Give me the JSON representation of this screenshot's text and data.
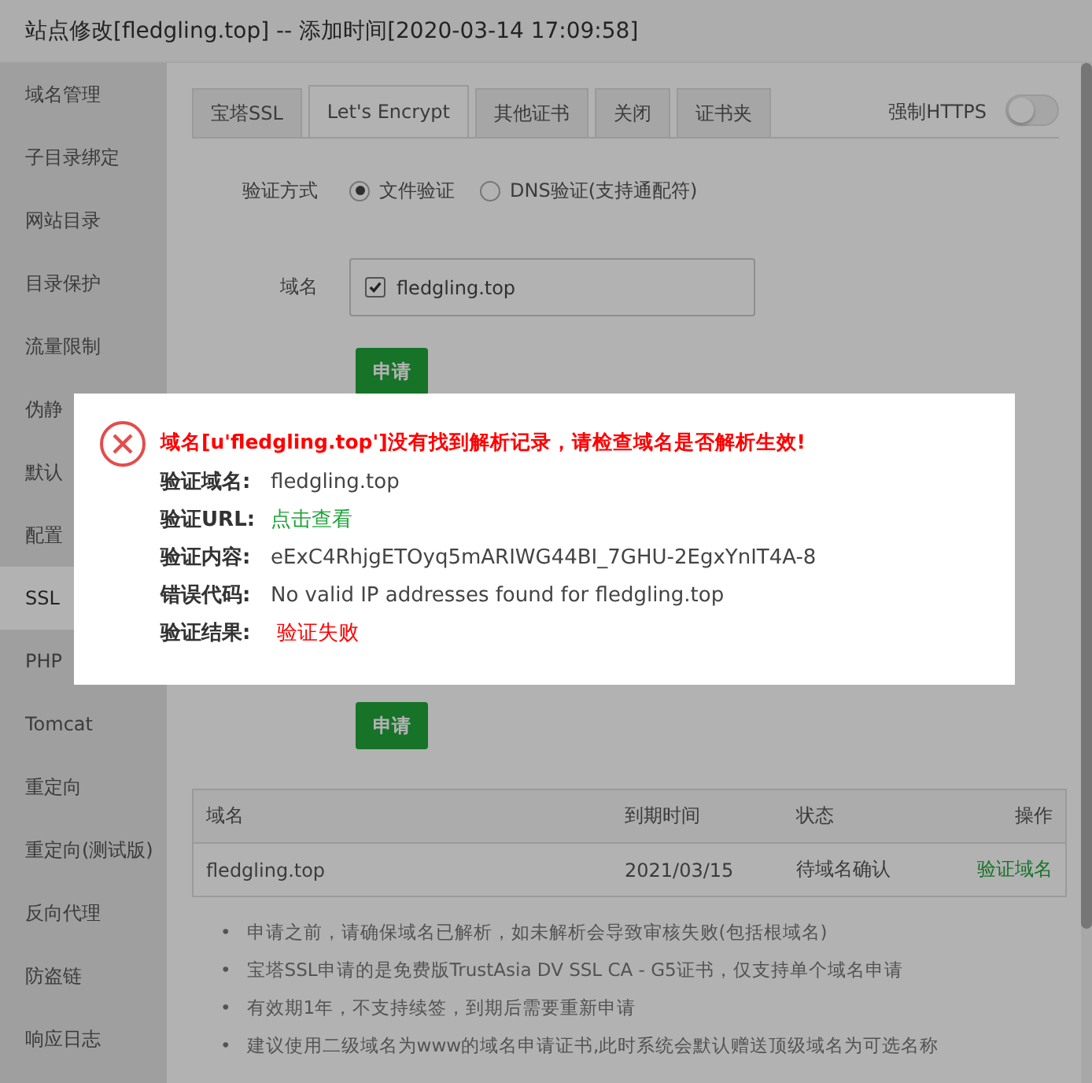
{
  "window": {
    "title": "站点修改[fledgling.top] -- 添加时间[2020-03-14 17:09:58]"
  },
  "sidebar": {
    "items": [
      {
        "label": "域名管理",
        "selected": false
      },
      {
        "label": "子目录绑定",
        "selected": false
      },
      {
        "label": "网站目录",
        "selected": false
      },
      {
        "label": "目录保护",
        "selected": false
      },
      {
        "label": "流量限制",
        "selected": false
      },
      {
        "label": "伪静",
        "selected": false
      },
      {
        "label": "默认",
        "selected": false
      },
      {
        "label": "配置",
        "selected": false
      },
      {
        "label": "SSL",
        "selected": true
      },
      {
        "label": "PHP",
        "selected": false
      },
      {
        "label": "Tomcat",
        "selected": false
      },
      {
        "label": "重定向",
        "selected": false
      },
      {
        "label": "重定向(测试版)",
        "selected": false
      },
      {
        "label": "反向代理",
        "selected": false
      },
      {
        "label": "防盗链",
        "selected": false
      },
      {
        "label": "响应日志",
        "selected": false
      }
    ]
  },
  "tabs": [
    {
      "label": "宝塔SSL",
      "selected": false
    },
    {
      "label": "Let's Encrypt",
      "selected": true
    },
    {
      "label": "其他证书",
      "selected": false
    },
    {
      "label": "关闭",
      "selected": false
    },
    {
      "label": "证书夹",
      "selected": false
    }
  ],
  "force_https": {
    "label": "强制HTTPS",
    "on": false
  },
  "verify_method": {
    "label": "验证方式",
    "options": [
      {
        "label": "文件验证",
        "selected": true
      },
      {
        "label": "DNS验证(支持通配符)",
        "selected": false
      }
    ]
  },
  "domains": {
    "label": "域名",
    "items": [
      {
        "label": "fledgling.top",
        "checked": true
      }
    ]
  },
  "apply_buttons": [
    "申请",
    "申请"
  ],
  "table": {
    "columns": [
      "域名",
      "到期时间",
      "状态",
      "操作"
    ],
    "rows": [
      {
        "cells": [
          "fledgling.top",
          "2021/03/15",
          "待域名确认"
        ],
        "action": "验证域名"
      }
    ]
  },
  "notes": [
    {
      "bullet": "•",
      "text": "申请之前，请确保域名已解析，如未解析会导致审核失败(包括根域名)"
    },
    {
      "bullet": "•",
      "text": "宝塔SSL申请的是免费版TrustAsia DV SSL CA - G5证书，仅支持单个域名申请"
    },
    {
      "bullet": "•",
      "text": "有效期1年，不支持续签，到期后需要重新申请"
    },
    {
      "bullet": "•",
      "text": "建议使用二级域名为www的域名申请证书,此时系统会默认赠送顶级域名为可选名称"
    }
  ],
  "dialog": {
    "message": "域名[u'fledgling.top']没有找到解析记录，请检查域名是否解析生效!",
    "fields": [
      {
        "label": "验证域名:",
        "value": "fledgling.top",
        "kind": "text"
      },
      {
        "label": "验证URL:",
        "value": "点击查看",
        "kind": "link"
      },
      {
        "label": "验证内容:",
        "value": "eExC4RhjgETOyq5mARIWG44BI_7GHU-2EgxYnIT4A-8",
        "kind": "text"
      },
      {
        "label": "错误代码:",
        "value": "No valid IP addresses found for fledgling.top",
        "kind": "text"
      },
      {
        "label": "验证结果:",
        "value": "验证失败",
        "kind": "error"
      }
    ]
  }
}
